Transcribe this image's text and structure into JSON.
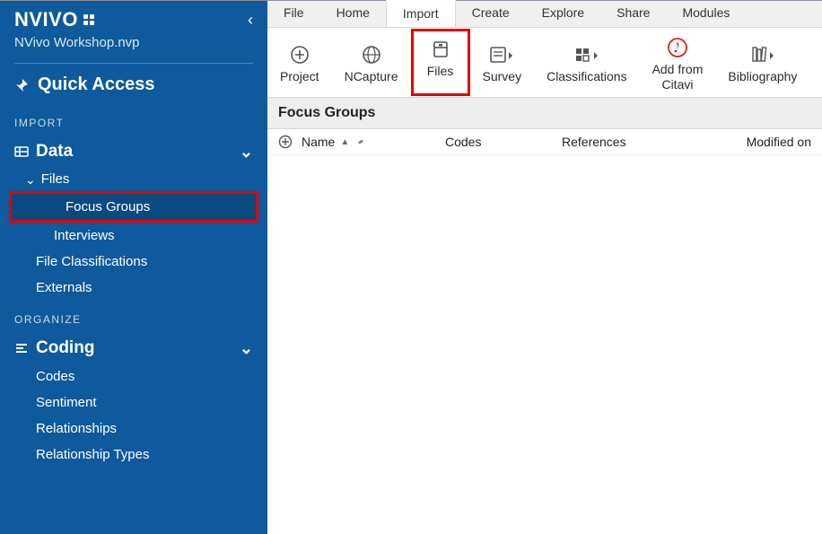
{
  "app": {
    "logo_text": "NVIVO",
    "collapse_glyph": "‹",
    "project_file": "NVivo Workshop.nvp"
  },
  "quick_access": {
    "label": "Quick Access"
  },
  "import_section": {
    "label": "IMPORT"
  },
  "organize_section": {
    "label": "ORGANIZE"
  },
  "tree": {
    "data": {
      "label": "Data",
      "expand_glyph": "⌄"
    },
    "files": {
      "label": "Files",
      "expand_glyph": "⌄"
    },
    "focus_groups": {
      "label": "Focus Groups"
    },
    "interviews": {
      "label": "Interviews"
    },
    "file_classifications": {
      "label": "File Classifications"
    },
    "externals": {
      "label": "Externals"
    },
    "coding": {
      "label": "Coding",
      "expand_glyph": "⌄"
    },
    "codes": {
      "label": "Codes"
    },
    "sentiment": {
      "label": "Sentiment"
    },
    "relationships": {
      "label": "Relationships"
    },
    "relationship_types": {
      "label": "Relationship Types"
    }
  },
  "menubar": {
    "file": "File",
    "home": "Home",
    "import": "Import",
    "create": "Create",
    "explore": "Explore",
    "share": "Share",
    "modules": "Modules"
  },
  "ribbon": {
    "project": "Project",
    "ncapture": "NCapture",
    "files": "Files",
    "survey": "Survey",
    "classifications": "Classifications",
    "add_from_citavi_line1": "Add from",
    "add_from_citavi_line2": "Citavi",
    "bibliography": "Bibliography"
  },
  "content": {
    "title": "Focus Groups",
    "columns": {
      "name": "Name",
      "codes": "Codes",
      "references": "References",
      "modified_on": "Modified on"
    }
  }
}
